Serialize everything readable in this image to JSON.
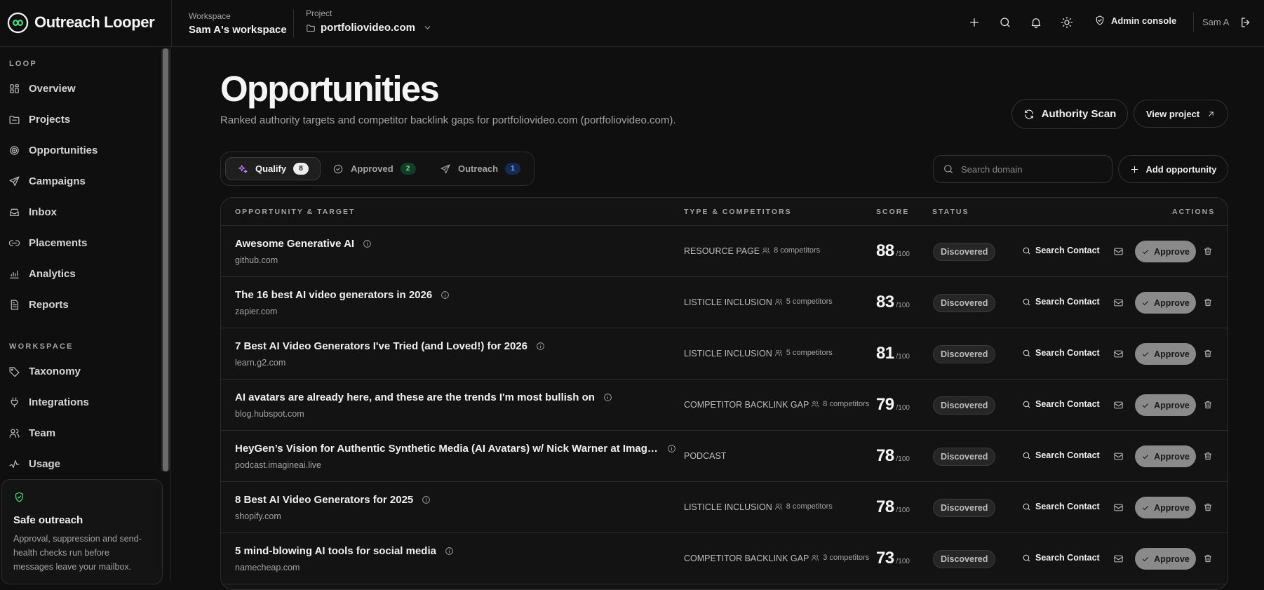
{
  "brand": {
    "name": "Outreach Looper"
  },
  "workspace": {
    "label": "Workspace",
    "name": "Sam A's workspace"
  },
  "project": {
    "label": "Project",
    "name": "portfoliovideo.com"
  },
  "topbar": {
    "admin_label": "Admin console",
    "user_name": "Sam A"
  },
  "sidebar": {
    "loop_title": "LOOP",
    "loop_items": [
      {
        "label": "Overview",
        "icon": "dashboard-icon"
      },
      {
        "label": "Projects",
        "icon": "folder-icon"
      },
      {
        "label": "Opportunities",
        "icon": "target-icon"
      },
      {
        "label": "Campaigns",
        "icon": "send-icon"
      },
      {
        "label": "Inbox",
        "icon": "inbox-icon"
      },
      {
        "label": "Placements",
        "icon": "link-icon"
      },
      {
        "label": "Analytics",
        "icon": "chart-icon"
      },
      {
        "label": "Reports",
        "icon": "report-icon"
      }
    ],
    "workspace_title": "WORKSPACE",
    "workspace_items": [
      {
        "label": "Taxonomy",
        "icon": "tag-icon"
      },
      {
        "label": "Integrations",
        "icon": "plug-icon"
      },
      {
        "label": "Team",
        "icon": "team-icon"
      },
      {
        "label": "Usage",
        "icon": "activity-icon"
      }
    ],
    "safe": {
      "title": "Safe outreach",
      "description": "Approval, suppression and send-health checks run before messages leave your mailbox."
    }
  },
  "page": {
    "title": "Opportunities",
    "subtitle": "Ranked authority targets and competitor backlink gaps for portfoliovideo.com (portfoliovideo.com).",
    "scan_label": "Authority Scan",
    "view_project_label": "View project",
    "add_label": "Add opportunity",
    "search_placeholder": "Search domain"
  },
  "tabs": [
    {
      "label": "Qualify",
      "count": "8",
      "active": true
    },
    {
      "label": "Approved",
      "count": "2",
      "active": false
    },
    {
      "label": "Outreach",
      "count": "1",
      "active": false
    }
  ],
  "table": {
    "headers": {
      "target": "OPPORTUNITY & TARGET",
      "type": "TYPE & COMPETITORS",
      "score": "SCORE",
      "status": "STATUS",
      "actions": "ACTIONS"
    },
    "score_suffix": "/100",
    "search_contact_label": "Search Contact",
    "approve_label": "Approve",
    "rows": [
      {
        "title": "Awesome Generative AI",
        "domain": "github.com",
        "type": "RESOURCE PAGE",
        "competitors": "8 competitors",
        "score": "88",
        "status": "Discovered"
      },
      {
        "title": "The 16 best AI video generators in 2026",
        "domain": "zapier.com",
        "type": "LISTICLE INCLUSION",
        "competitors": "5 competitors",
        "score": "83",
        "status": "Discovered"
      },
      {
        "title": "7 Best AI Video Generators I've Tried (and Loved!) for 2026",
        "domain": "learn.g2.com",
        "type": "LISTICLE INCLUSION",
        "competitors": "5 competitors",
        "score": "81",
        "status": "Discovered"
      },
      {
        "title": "AI avatars are already here, and these are the trends I'm most bullish on",
        "domain": "blog.hubspot.com",
        "type": "COMPETITOR BACKLINK GAP",
        "competitors": "8 competitors",
        "score": "79",
        "status": "Discovered"
      },
      {
        "title": "HeyGen’s Vision for Authentic Synthetic Media (AI Avatars) w/ Nick Warner at Imagine...",
        "domain": "podcast.imagineai.live",
        "type": "PODCAST",
        "competitors": "",
        "score": "78",
        "status": "Discovered"
      },
      {
        "title": "8 Best AI Video Generators for 2025",
        "domain": "shopify.com",
        "type": "LISTICLE INCLUSION",
        "competitors": "8 competitors",
        "score": "78",
        "status": "Discovered"
      },
      {
        "title": "5 mind-blowing AI tools for social media",
        "domain": "namecheap.com",
        "type": "COMPETITOR BACKLINK GAP",
        "competitors": "3 competitors",
        "score": "73",
        "status": "Discovered"
      }
    ]
  },
  "colors": {
    "accent_green": "#4ade80",
    "approve_bg": "#8a8a8a",
    "background": "#0f0f0f"
  }
}
